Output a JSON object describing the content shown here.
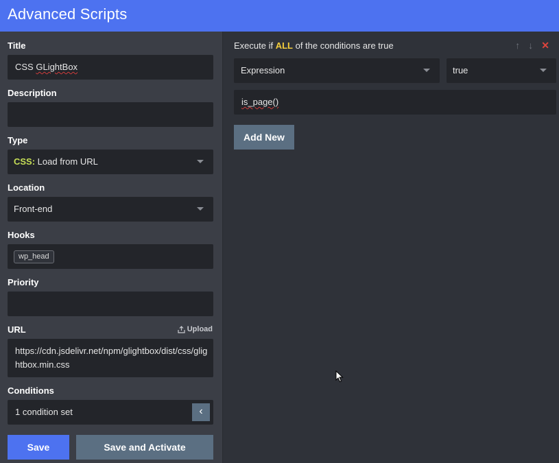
{
  "header": {
    "title": "Advanced Scripts"
  },
  "form": {
    "title": {
      "label": "Title",
      "value": "CSS GLightBox",
      "value_prefix": "CSS ",
      "value_misspelled": "GLightBox"
    },
    "description": {
      "label": "Description",
      "value": ""
    },
    "type": {
      "label": "Type",
      "value_keyword": "CSS:",
      "value_rest": " Load from URL"
    },
    "location": {
      "label": "Location",
      "value": "Front-end"
    },
    "hooks": {
      "label": "Hooks",
      "tags": [
        "wp_head"
      ]
    },
    "priority": {
      "label": "Priority",
      "value": ""
    },
    "url": {
      "label": "URL",
      "upload_label": "Upload",
      "value": "https://cdn.jsdelivr.net/npm/glightbox/dist/css/glightbox.min.css"
    },
    "conditions": {
      "label": "Conditions",
      "value": "1 condition set"
    }
  },
  "buttons": {
    "save": "Save",
    "save_activate": "Save and Activate"
  },
  "conditions_panel": {
    "heading_pre": "Execute if ",
    "heading_keyword": "ALL",
    "heading_post": " of the conditions are true",
    "type_select": "Expression",
    "value_select": "true",
    "expression": "is_page()",
    "add_new": "Add New",
    "icons": {
      "up": "↑",
      "down": "↓",
      "close": "✕"
    }
  },
  "colors": {
    "accent": "#4d72f0",
    "secondary_button": "#5b6f82",
    "keyword_all": "#f3cc3c",
    "keyword_css": "#c7df56",
    "danger": "#e0443d"
  }
}
